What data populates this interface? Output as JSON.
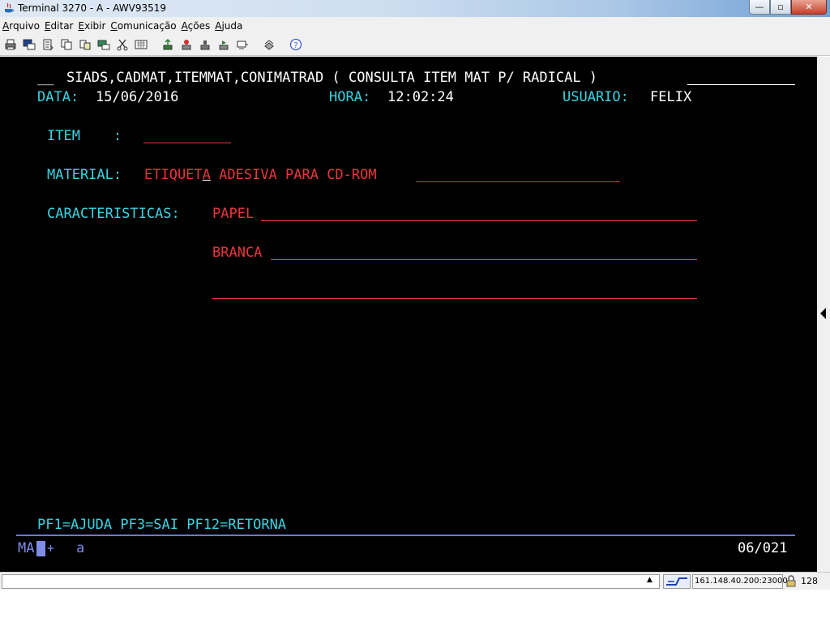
{
  "window": {
    "title": "Terminal 3270 - A - AWV93519",
    "minimize_glyph": "—",
    "maximize_glyph": "▫",
    "close_glyph": "✕"
  },
  "menu": {
    "items": [
      {
        "label": "Arquivo",
        "key": "A",
        "rest": "rquivo"
      },
      {
        "label": "Editar",
        "key": "E",
        "rest": "ditar"
      },
      {
        "label": "Exibir",
        "key": "E",
        "rest": "xibir"
      },
      {
        "label": "Comunicação",
        "key": "C",
        "rest": "omunicação"
      },
      {
        "label": "Ações",
        "key": "A",
        "rest": "ções"
      },
      {
        "label": "Ajuda",
        "key": "A",
        "rest": "juda"
      }
    ]
  },
  "toolbar": {
    "icons": [
      "print-icon",
      "copy-screen-icon",
      "paste-icon",
      "copy-icon",
      "cut-icon",
      "copy-append-icon",
      "macro-icon",
      "keypad-icon",
      "send-file-icon",
      "receive-file-icon",
      "record-icon",
      "stop-icon",
      "play-icon",
      "settings-icon",
      "help-icon"
    ]
  },
  "terminal": {
    "header_prefix": "__",
    "header_title": "SIADS,CADMAT,ITEMMAT,CONIMATRAD ( CONSULTA ITEM MAT P/ RADICAL )",
    "date_label": "DATA:",
    "date_value": "15/06/2016",
    "time_label": "HORA:",
    "time_value": "12:02:24",
    "user_label": "USUARIO:",
    "user_value": "FELIX",
    "item_label": "ITEM    :",
    "material_label": "MATERIAL:",
    "material_value_a": "ETIQUET",
    "material_value_cursor": "A",
    "material_value_b": " ADESIVA PARA CD-ROM",
    "characteristics_label": "CARACTERISTICAS:",
    "characteristic_1": "PAPEL",
    "characteristic_2": "BRANCA",
    "characteristic_3": "",
    "function_keys": "PF1=AJUDA PF3=SAI PF12=RETORNA",
    "oia_mode": "MA",
    "oia_plus": "+",
    "oia_char": "a",
    "cursor_position": "06/021",
    "colors": {
      "background": "#000000",
      "label": "#39d5e4",
      "value": "#e8363c",
      "text": "#ffffff",
      "oia": "#7f8ce8"
    }
  },
  "statusbar": {
    "host": "161.148.40.200:23000",
    "count": "128"
  }
}
